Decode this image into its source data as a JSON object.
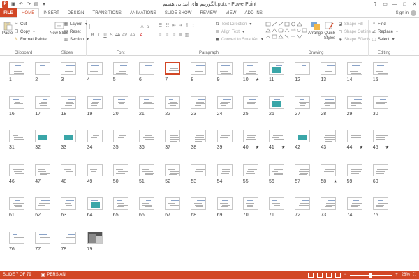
{
  "window": {
    "title": "الگوریتم های ابتدایی هستم.pptx - PowerPoint",
    "controls": [
      "?",
      "▭",
      "—",
      "□",
      "✕"
    ]
  },
  "tabs": [
    {
      "label": "FILE"
    },
    {
      "label": "HOME"
    },
    {
      "label": "INSERT"
    },
    {
      "label": "DESIGN"
    },
    {
      "label": "TRANSITIONS"
    },
    {
      "label": "ANIMATIONS"
    },
    {
      "label": "SLIDE SHOW"
    },
    {
      "label": "REVIEW"
    },
    {
      "label": "VIEW"
    },
    {
      "label": "ADD-INS"
    }
  ],
  "active_tab": "HOME",
  "sign_in": "Sign in",
  "ribbon": {
    "clipboard": {
      "label": "Clipboard",
      "paste": "Paste",
      "cut": "Cut",
      "copy": "Copy",
      "format_painter": "Format Painter"
    },
    "slides": {
      "label": "Slides",
      "new_slide": "New Slide",
      "layout": "Layout",
      "reset": "Reset",
      "section": "Section"
    },
    "font": {
      "label": "Font"
    },
    "paragraph": {
      "label": "Paragraph",
      "text_direction": "Text Direction",
      "align_text": "Align Text",
      "convert_smartart": "Convert to SmartArt"
    },
    "drawing": {
      "label": "Drawing",
      "arrange": "Arrange",
      "quick_styles": "Quick Styles",
      "shape_fill": "Shape Fill",
      "shape_outline": "Shape Outline",
      "shape_effects": "Shape Effects"
    },
    "editing": {
      "label": "Editing",
      "find": "Find",
      "replace": "Replace",
      "select": "Select"
    }
  },
  "slides": {
    "selected": 7,
    "starred": [
      10,
      40,
      41,
      44,
      45,
      58
    ],
    "teal": [
      11,
      26,
      32,
      33,
      42,
      64
    ],
    "photo": [
      79
    ],
    "total": 79
  },
  "status": {
    "slide_indicator": "SLIDE 7 OF 79",
    "language": "PERSIAN",
    "zoom": "28%",
    "zoom_fraction": 0.48
  },
  "colors": {
    "accent": "#d24726",
    "teal": "#3aa6a8"
  }
}
